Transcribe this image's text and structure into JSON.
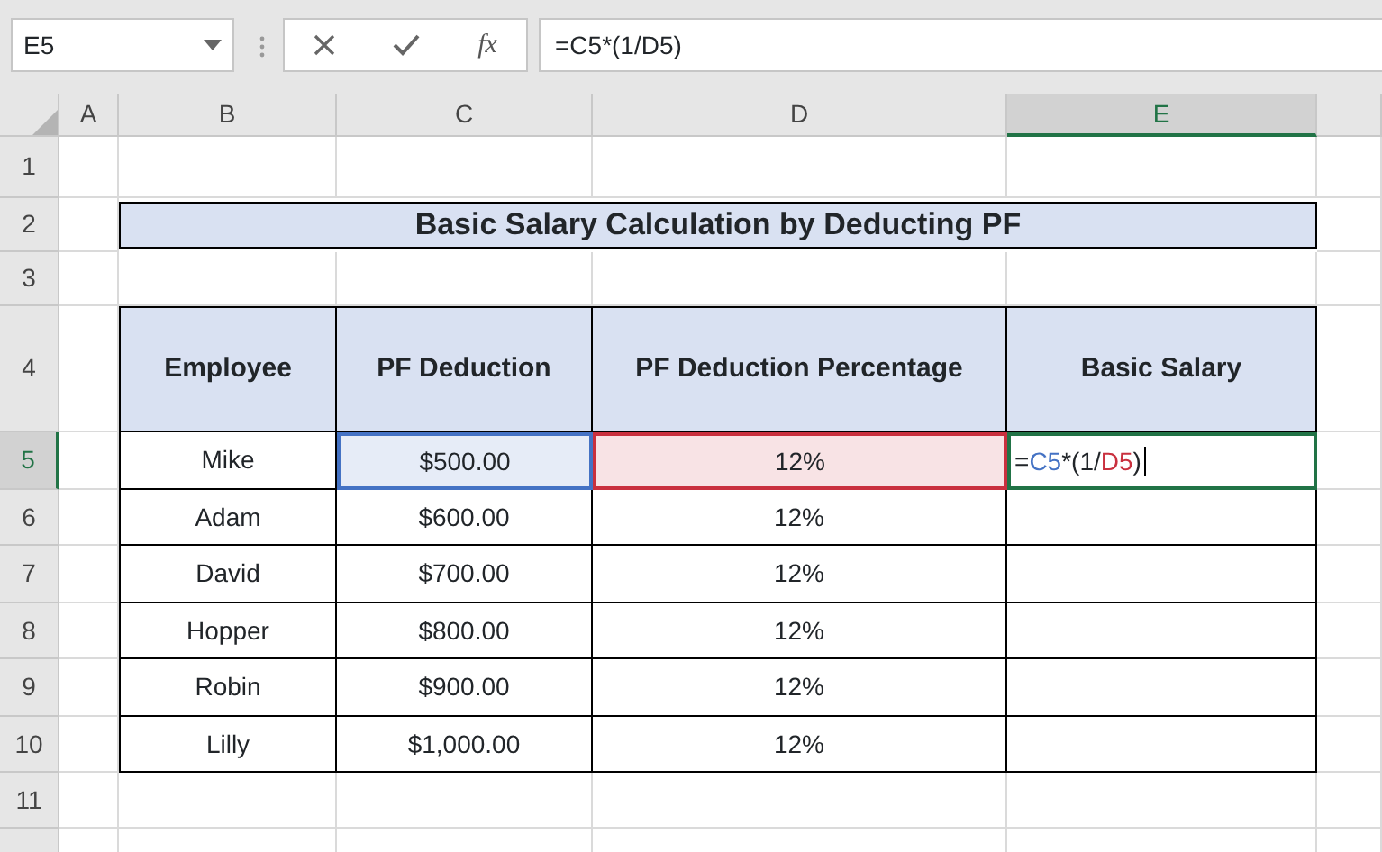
{
  "name_box": "E5",
  "formula_bar": {
    "fx_label": "fx",
    "value": "=C5*(1/D5)"
  },
  "columns": [
    {
      "label": "A",
      "selected": false
    },
    {
      "label": "B",
      "selected": false
    },
    {
      "label": "C",
      "selected": false
    },
    {
      "label": "D",
      "selected": false
    },
    {
      "label": "E",
      "selected": true
    }
  ],
  "rows": [
    {
      "label": "1",
      "selected": false
    },
    {
      "label": "2",
      "selected": false
    },
    {
      "label": "3",
      "selected": false
    },
    {
      "label": "4",
      "selected": false
    },
    {
      "label": "5",
      "selected": true
    },
    {
      "label": "6",
      "selected": false
    },
    {
      "label": "7",
      "selected": false
    },
    {
      "label": "8",
      "selected": false
    },
    {
      "label": "9",
      "selected": false
    },
    {
      "label": "10",
      "selected": false
    },
    {
      "label": "11",
      "selected": false
    }
  ],
  "title": "Basic Salary Calculation by Deducting PF",
  "table": {
    "columns": [
      "Employee",
      "PF Deduction",
      "PF Deduction Percentage",
      "Basic Salary"
    ],
    "rows": [
      {
        "cells": [
          {
            "text": "Mike"
          },
          {
            "text": "$500.00",
            "color": "#4472c4"
          },
          {
            "text": "12%",
            "color": "#c9303e"
          },
          {
            "kind": "formula",
            "selected": true,
            "parts": [
              {
                "text": "="
              },
              {
                "text": "C5",
                "color": "#4472c4"
              },
              {
                "text": "*(1/"
              },
              {
                "text": "D5",
                "color": "#c9303e"
              },
              {
                "text": ")"
              }
            ]
          }
        ]
      },
      {
        "cells": [
          {
            "text": "Adam"
          },
          {
            "text": "$600.00"
          },
          {
            "text": "12%"
          },
          {
            "text": ""
          }
        ]
      },
      {
        "cells": [
          {
            "text": "David"
          },
          {
            "text": "$700.00"
          },
          {
            "text": "12%"
          },
          {
            "text": ""
          }
        ]
      },
      {
        "cells": [
          {
            "text": "Hopper"
          },
          {
            "text": "$800.00"
          },
          {
            "text": "12%"
          },
          {
            "text": ""
          }
        ]
      },
      {
        "cells": [
          {
            "text": "Robin"
          },
          {
            "text": "$900.00"
          },
          {
            "text": "12%"
          },
          {
            "text": ""
          }
        ]
      },
      {
        "cells": [
          {
            "text": "Lilly"
          },
          {
            "text": "$1,000.00"
          },
          {
            "text": "12%"
          },
          {
            "text": ""
          }
        ]
      }
    ]
  }
}
